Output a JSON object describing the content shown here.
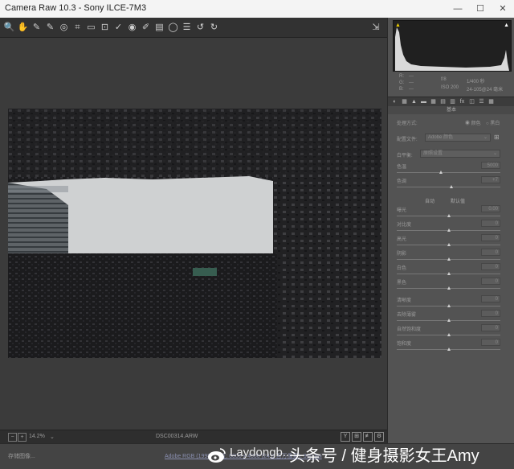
{
  "window": {
    "title": "Camera Raw 10.3 -  Sony ILCE-7M3",
    "controls": [
      "—",
      "☐",
      "✕"
    ]
  },
  "toolbar": {
    "tools": [
      {
        "name": "zoom-tool-icon",
        "glyph": "🔍"
      },
      {
        "name": "hand-tool-icon",
        "glyph": "✋"
      },
      {
        "name": "white-balance-tool-icon",
        "glyph": "✎"
      },
      {
        "name": "color-sampler-tool-icon",
        "glyph": "✎"
      },
      {
        "name": "targeted-adjustment-tool-icon",
        "glyph": "◎"
      },
      {
        "name": "crop-tool-icon",
        "glyph": "⌗"
      },
      {
        "name": "straighten-tool-icon",
        "glyph": "▭"
      },
      {
        "name": "transform-tool-icon",
        "glyph": "⊡"
      },
      {
        "name": "spot-removal-tool-icon",
        "glyph": "✓"
      },
      {
        "name": "red-eye-tool-icon",
        "glyph": "◉"
      },
      {
        "name": "adjustment-brush-icon",
        "glyph": "✐"
      },
      {
        "name": "graduated-filter-icon",
        "glyph": "▤"
      },
      {
        "name": "radial-filter-icon",
        "glyph": "◯"
      },
      {
        "name": "preferences-icon",
        "glyph": "☰"
      },
      {
        "name": "rotate-ccw-icon",
        "glyph": "↺"
      },
      {
        "name": "rotate-cw-icon",
        "glyph": "↻"
      }
    ],
    "fullscreen_glyph": "⇲"
  },
  "histogram": {
    "clip_shadow_glyph": "▲",
    "clip_highlight_glyph": "▲",
    "colors": {
      "background": "#202020",
      "fill": "#d9d9d9",
      "shadow_warning": "#f0d000",
      "highlight_warning": "#ffffff"
    }
  },
  "metadata": {
    "rgb_r": "R:",
    "rgb_g": "G:",
    "rgb_b": "B:",
    "rgb_dash": "---",
    "aperture": "f/8",
    "shutter": "1/400 秒",
    "iso": "ISO 200",
    "lens": "24-105@24 毫米"
  },
  "panel_tabs": [
    "◐",
    "▦",
    "▲",
    "▬",
    "▦",
    "▤",
    "▥",
    "fx",
    "◫",
    "☰",
    "▦"
  ],
  "panel": {
    "header": "基本",
    "treatment_label": "处理方式:",
    "treatment_color": "颜色",
    "treatment_bw": "黑白",
    "profile_label": "配置文件:",
    "profile_value": "Adobe 颜色",
    "profile_grid_glyph": "⊞",
    "wb_label": "白平衡:",
    "wb_value": "原照设置",
    "temp_label": "色温",
    "temp_value": "5000",
    "tint_label": "色调",
    "tint_value": "+7",
    "auto_label": "自动",
    "default_label": "默认值",
    "sliders": [
      {
        "label": "曝光",
        "value": "0.00",
        "pos": 0.5
      },
      {
        "label": "对比度",
        "value": "0",
        "pos": 0.5
      },
      {
        "label": "高光",
        "value": "0",
        "pos": 0.5
      },
      {
        "label": "阴影",
        "value": "0",
        "pos": 0.5
      },
      {
        "label": "白色",
        "value": "0",
        "pos": 0.5
      },
      {
        "label": "黑色",
        "value": "0",
        "pos": 0.5
      }
    ],
    "sliders2": [
      {
        "label": "清晰度",
        "value": "0",
        "pos": 0.5
      },
      {
        "label": "去除薄雾",
        "value": "0",
        "pos": 0.5
      },
      {
        "label": "自然饱和度",
        "value": "0",
        "pos": 0.5
      },
      {
        "label": "饱和度",
        "value": "0",
        "pos": 0.5
      }
    ],
    "temp_pos": 0.43,
    "tint_pos": 0.53
  },
  "statusbar": {
    "zoom_out": "−",
    "zoom_in": "+",
    "zoom": "14.2%",
    "zoom_dd": "⌄",
    "filename": "DSC00314.ARW",
    "view_buttons": [
      "Y",
      "⊞",
      "≢",
      "⚙"
    ]
  },
  "bottom": {
    "save_label": "存储图像...",
    "workflow": "Adobe RGB (1998); 8 位; 6000 x 4000 (24.0 百万像素); 300 ppi",
    "watermark_name": "Laydongb...",
    "watermark_title": "头条号 / 健身摄影女王Amy"
  }
}
